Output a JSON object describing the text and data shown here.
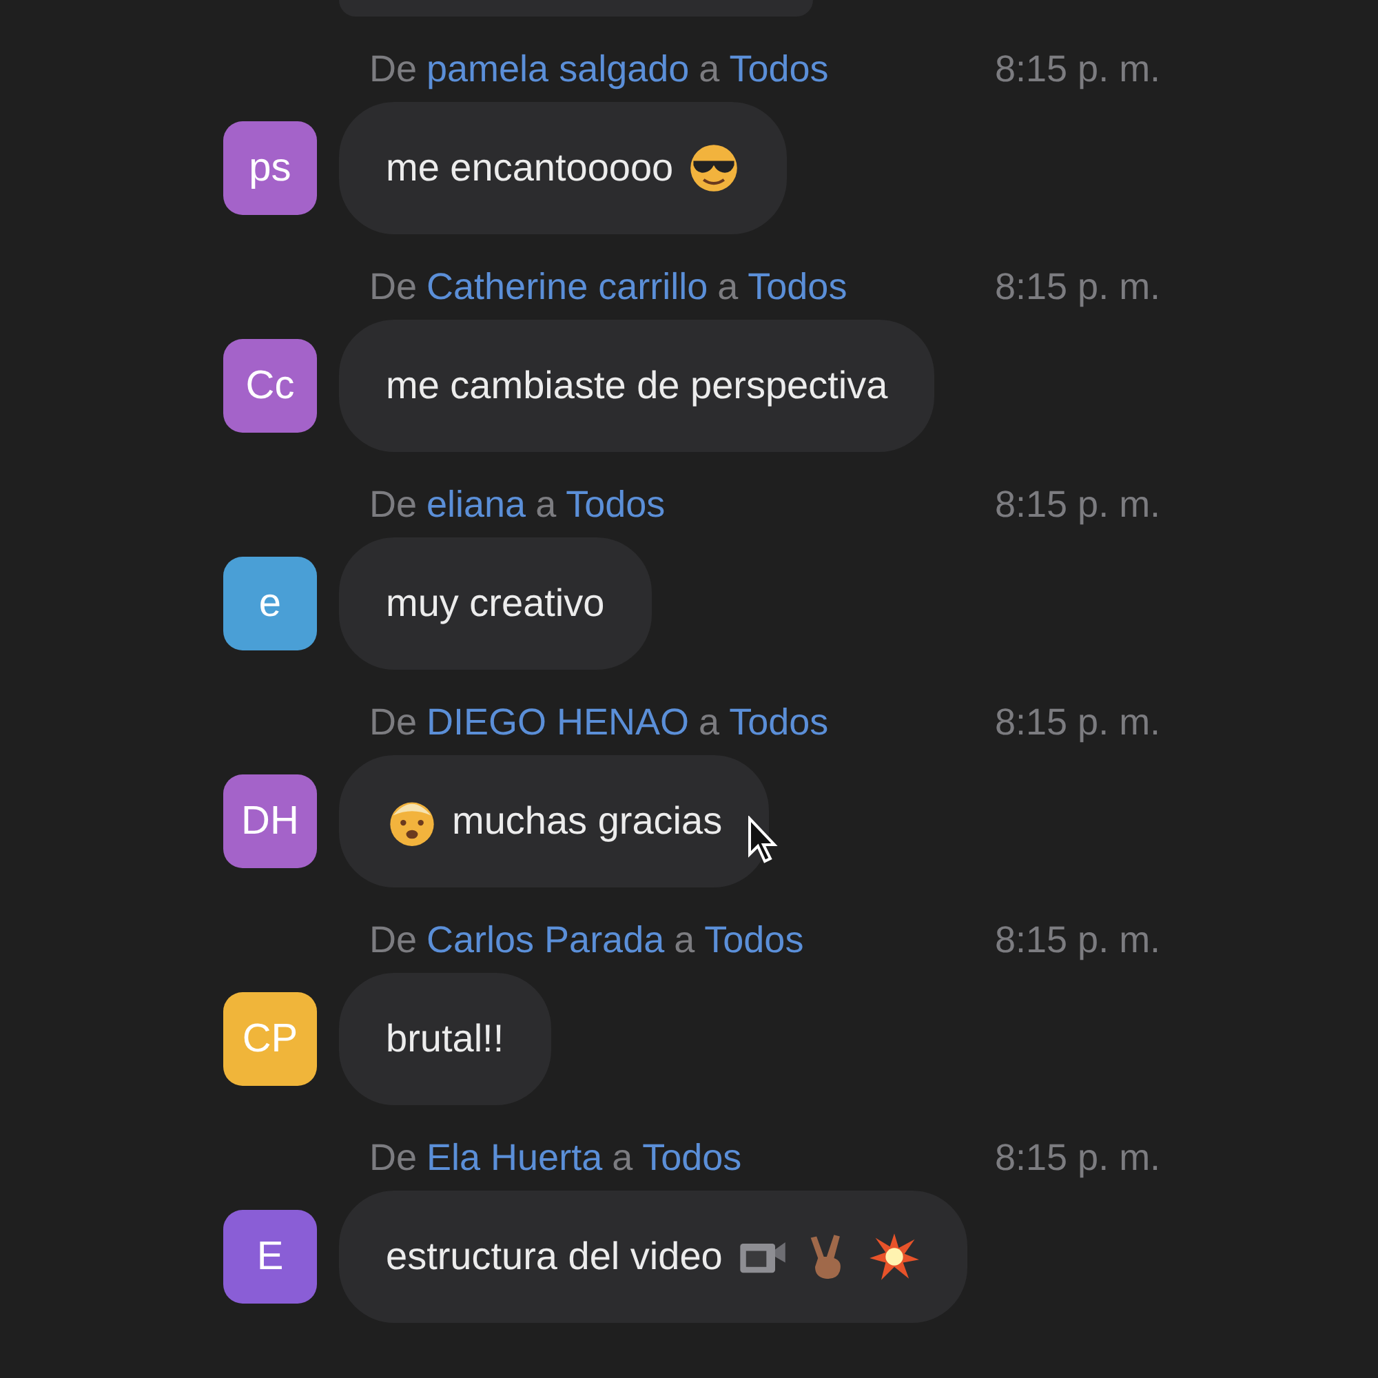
{
  "messages": [
    {
      "from_label": "De",
      "sender": "pamela salgado",
      "to_label": "a",
      "recipient": "Todos",
      "time": "8:15 p. m.",
      "initials": "ps",
      "color": "#a463c9",
      "text": "me encantooooo"
    },
    {
      "from_label": "De",
      "sender": "Catherine carrillo",
      "to_label": "a",
      "recipient": "Todos",
      "time": "8:15 p. m.",
      "initials": "Cc",
      "color": "#a463c9",
      "text": "me cambiaste de perspectiva"
    },
    {
      "from_label": "De",
      "sender": "eliana",
      "to_label": "a",
      "recipient": "Todos",
      "time": "8:15 p. m.",
      "initials": "e",
      "color": "#4a9fd6",
      "text": "muy creativo"
    },
    {
      "from_label": "De",
      "sender": "DIEGO HENAO",
      "to_label": "a",
      "recipient": "Todos",
      "time": "8:15 p. m.",
      "initials": "DH",
      "color": "#a463c9",
      "text": "muchas gracias"
    },
    {
      "from_label": "De",
      "sender": "Carlos Parada",
      "to_label": "a",
      "recipient": "Todos",
      "time": "8:15 p. m.",
      "initials": "CP",
      "color": "#f0b53a",
      "text": "brutal!!"
    },
    {
      "from_label": "De",
      "sender": "Ela Huerta",
      "to_label": "a",
      "recipient": "Todos",
      "time": "8:15 p. m.",
      "initials": "E",
      "color": "#8a5ed6",
      "text": "estructura del video"
    }
  ]
}
